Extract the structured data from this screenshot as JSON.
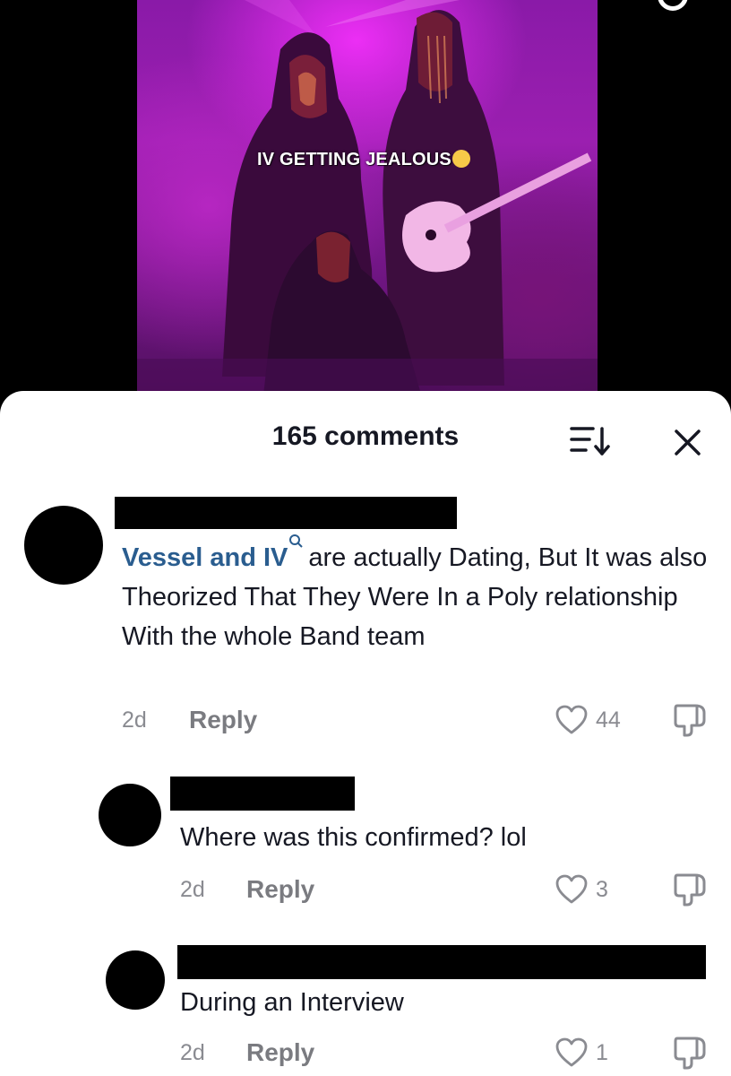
{
  "video": {
    "caption": "IV GETTING JEALOUS"
  },
  "comments_sheet": {
    "title": "165 comments",
    "comments": [
      {
        "mention": "Vessel and IV",
        "text": "are actually Dating, But It was also Theorized That They Were In a Poly relationship With the whole Band team",
        "time": "2d",
        "reply_label": "Reply",
        "likes": "44"
      },
      {
        "text": "Where was this confirmed? lol",
        "time": "2d",
        "reply_label": "Reply",
        "likes": "3"
      },
      {
        "text": "During an Interview",
        "time": "2d",
        "reply_label": "Reply",
        "likes": "1"
      }
    ]
  },
  "colors": {
    "mention": "#2a5d8f",
    "muted": "#8a8b91",
    "text": "#161823",
    "video_tint": "#9b1fb0"
  },
  "icons": [
    "search-icon",
    "sort-icon",
    "close-icon",
    "heart-icon",
    "dislike-icon",
    "mention-search-icon",
    "crying-emoji-icon"
  ]
}
